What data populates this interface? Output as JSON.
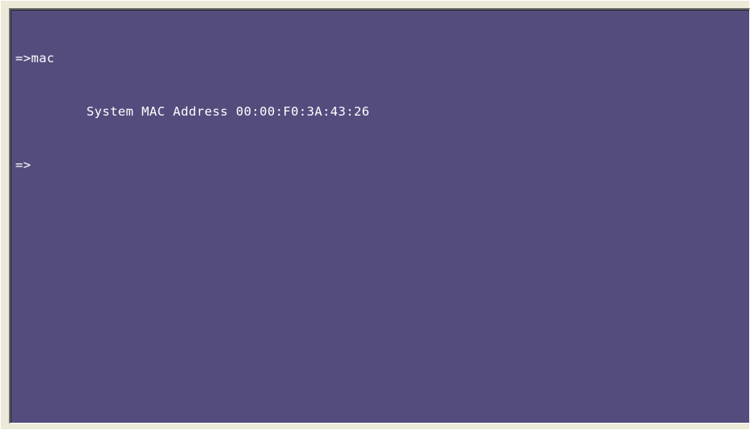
{
  "terminal": {
    "background_color": "#544c7d",
    "text_color": "#ffffff",
    "lines": [
      {
        "prompt": "=>",
        "command": "mac"
      },
      {
        "output": "System MAC Address 00:00:F0:3A:43:26"
      },
      {
        "prompt": "=>",
        "command": ""
      }
    ]
  }
}
